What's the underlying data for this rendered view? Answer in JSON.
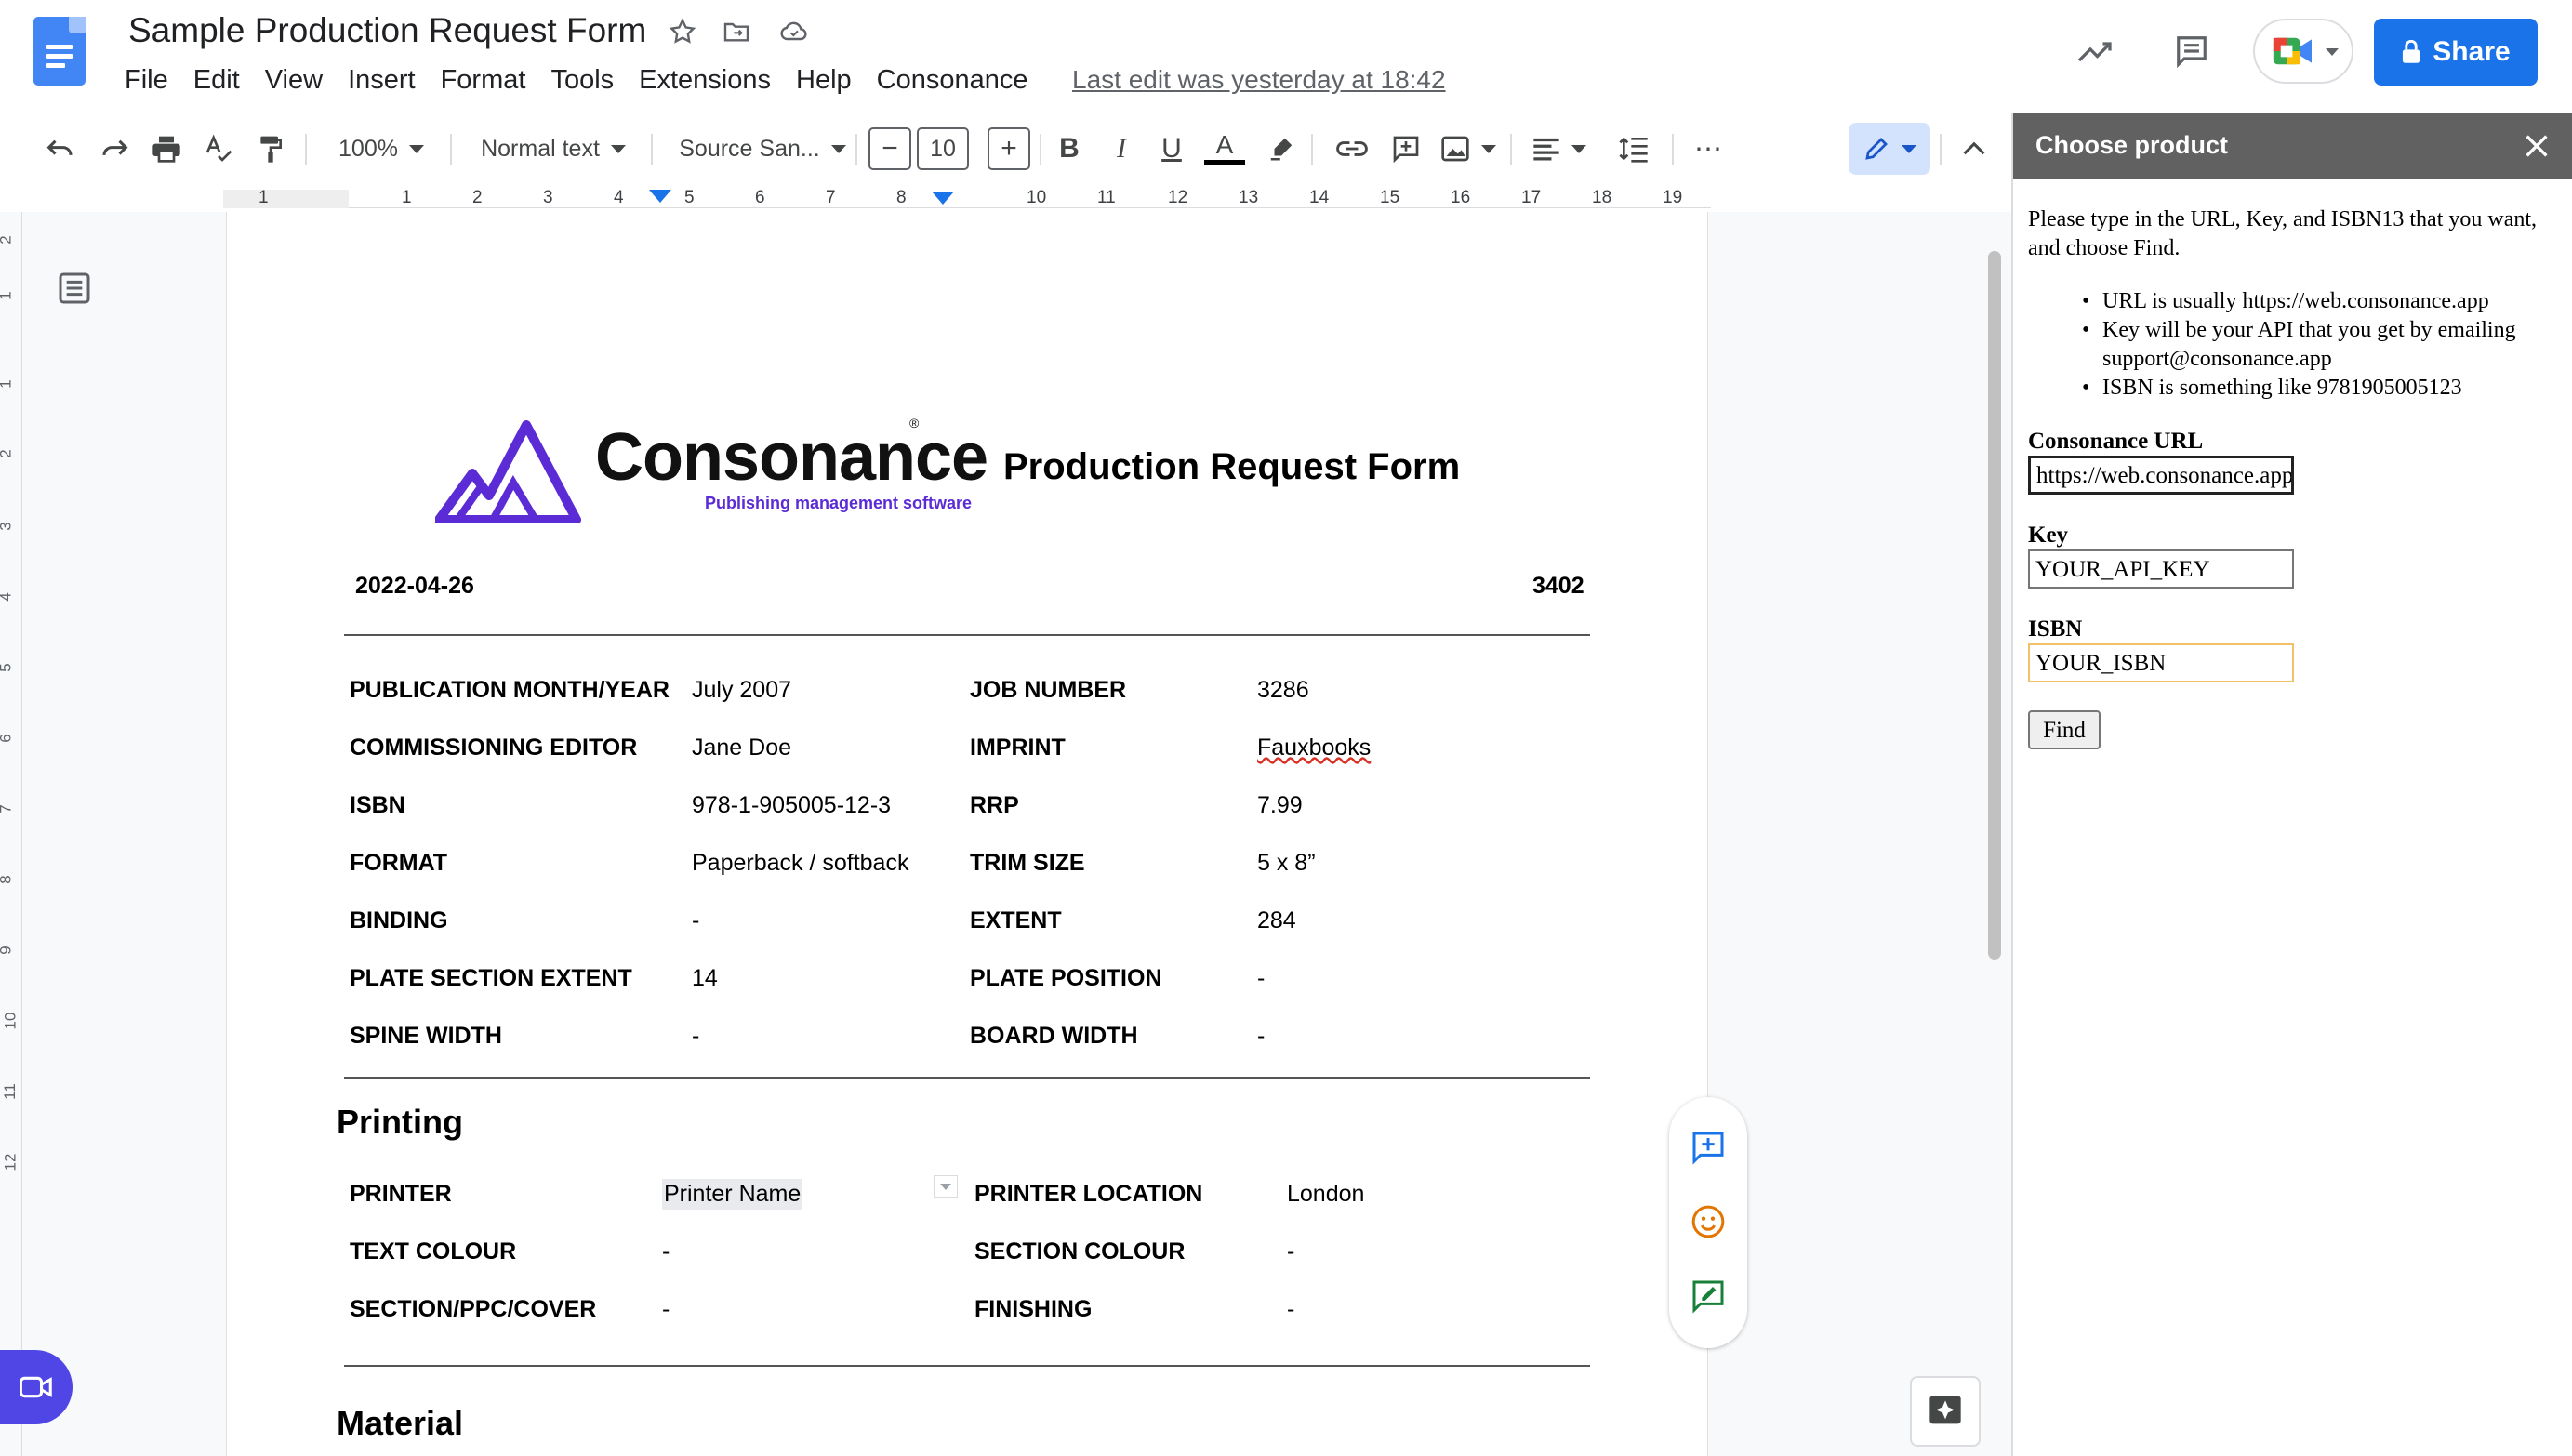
{
  "app": {
    "doc_title": "Sample Production Request Form",
    "menus": [
      "File",
      "Edit",
      "View",
      "Insert",
      "Format",
      "Tools",
      "Extensions",
      "Help",
      "Consonance"
    ],
    "last_edit": "Last edit was yesterday at 18:42",
    "share_label": "Share"
  },
  "toolbar": {
    "zoom": "100%",
    "style": "Normal text",
    "font": "Source San...",
    "font_size": "10"
  },
  "ruler": {
    "numbers": [
      "1",
      "1",
      "2",
      "3",
      "4",
      "5",
      "6",
      "7",
      "8",
      "10",
      "11",
      "12",
      "13",
      "14",
      "15",
      "16",
      "17",
      "18",
      "19"
    ],
    "vertical_numbers": [
      "2",
      "1",
      "1",
      "2",
      "3",
      "4",
      "5",
      "6",
      "7",
      "8",
      "9",
      "10",
      "11",
      "12"
    ]
  },
  "document": {
    "logo_name": "Consonance",
    "logo_tagline": "Publishing management software",
    "heading": "Production Request Form",
    "date": "2022-04-26",
    "number": "3402",
    "details": [
      {
        "label": "PUBLICATION MONTH/YEAR",
        "value": "July 2007",
        "label2": "JOB NUMBER",
        "value2": "3286"
      },
      {
        "label": "COMMISSIONING EDITOR",
        "value": "Jane Doe",
        "label2": "IMPRINT",
        "value2": "Fauxbooks"
      },
      {
        "label": "ISBN",
        "value": "978-1-905005-12-3",
        "label2": "RRP",
        "value2": "7.99"
      },
      {
        "label": "FORMAT",
        "value": "Paperback / softback",
        "label2": "TRIM SIZE",
        "value2": "5 x 8”"
      },
      {
        "label": "BINDING",
        "value": "-",
        "label2": "EXTENT",
        "value2": "284"
      },
      {
        "label": "PLATE SECTION EXTENT",
        "value": "14",
        "label2": "PLATE POSITION",
        "value2": "-"
      },
      {
        "label": "SPINE WIDTH",
        "value": "-",
        "label2": "BOARD WIDTH",
        "value2": "-"
      }
    ],
    "printing_heading": "Printing",
    "printing": [
      {
        "label": "PRINTER",
        "value": "Printer Name",
        "label2": "PRINTER LOCATION",
        "value2": "London"
      },
      {
        "label": "TEXT COLOUR",
        "value": "-",
        "label2": "SECTION COLOUR",
        "value2": "-"
      },
      {
        "label": "SECTION/PPC/COVER",
        "value": "-",
        "label2": "FINISHING",
        "value2": "-"
      }
    ],
    "material_heading": "Material"
  },
  "panel": {
    "title": "Choose product",
    "intro": "Please type in the URL, Key, and ISBN13 that you want, and choose Find.",
    "bullets": [
      "URL is usually https://web.consonance.app",
      "Key will be your API that you get by emailing support@consonance.app",
      "ISBN is something like 9781905005123"
    ],
    "url_label": "Consonance URL",
    "url_value": "https://web.consonance.app",
    "key_label": "Key",
    "key_value": "YOUR_API_KEY",
    "isbn_label": "ISBN",
    "isbn_value": "YOUR_ISBN",
    "find_label": "Find"
  },
  "colors": {
    "accent": "#1a73e8",
    "panel_header": "#616161",
    "logo_purple": "#5b2bd6",
    "meet_button": "#4f46e5"
  }
}
